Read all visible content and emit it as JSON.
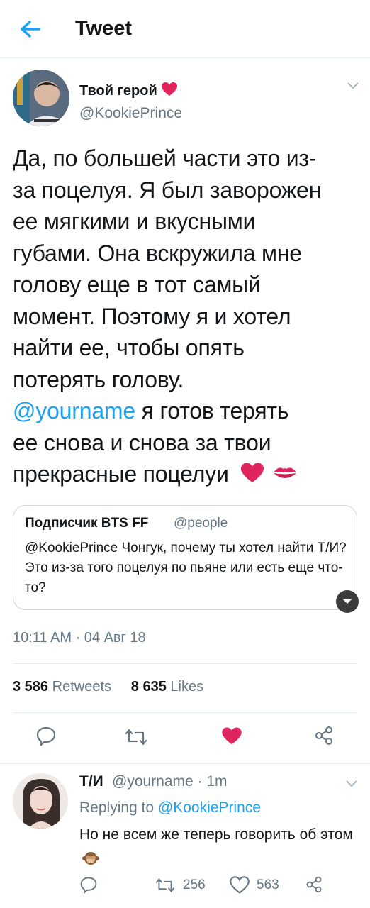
{
  "header": {
    "title": "Tweet"
  },
  "tweet": {
    "name": "Твой герой",
    "handle": "@KookiePrince",
    "text_lines": [
      "Да, по большей части это из-",
      "за поцелуя. Я был заворожен",
      "ее мягкими и вкусными",
      "губами. Она вскружила мне",
      "голову еще в тот самый",
      "момент. Поэтому я и хотел",
      "найти ее, чтобы опять",
      "потерять голову."
    ],
    "mention": "@yourname",
    "text_after_mention": " я готов терять",
    "text_tail_lines": [
      "ее снова и снова за твои",
      "прекрасные поцелуи"
    ],
    "timestamp": "10:11 AM · 04 Авг 18",
    "retweets_count": "3 586",
    "retweets_label": "Retweets",
    "likes_count": "8 635",
    "likes_label": "Likes"
  },
  "quote": {
    "name": "Подписчик BTS FF",
    "handle": "@people",
    "text": "@KookiePrince Чонгук, почему ты хотел найти Т/И? Это из-за того поцелуя по пьяне или есть еще что-то?"
  },
  "reply": {
    "name": "Т/И",
    "meta": "@yourname · 1m",
    "replying_prefix": "Replying to ",
    "replying_to": "@KookiePrince",
    "text": "Но не всем же теперь говорить об этом",
    "retweets": "256",
    "likes": "563"
  },
  "colors": {
    "accent": "#1da1f2",
    "like_red": "#e0245e",
    "muted": "#657786",
    "border": "#e6ecf0"
  },
  "icons": [
    "back-arrow-icon",
    "chevron-down-icon",
    "heart-emoji-icon",
    "kiss-emoji-icon",
    "reply-icon",
    "retweet-icon",
    "like-icon",
    "share-icon",
    "monkey-emoji-icon",
    "expand-icon"
  ]
}
